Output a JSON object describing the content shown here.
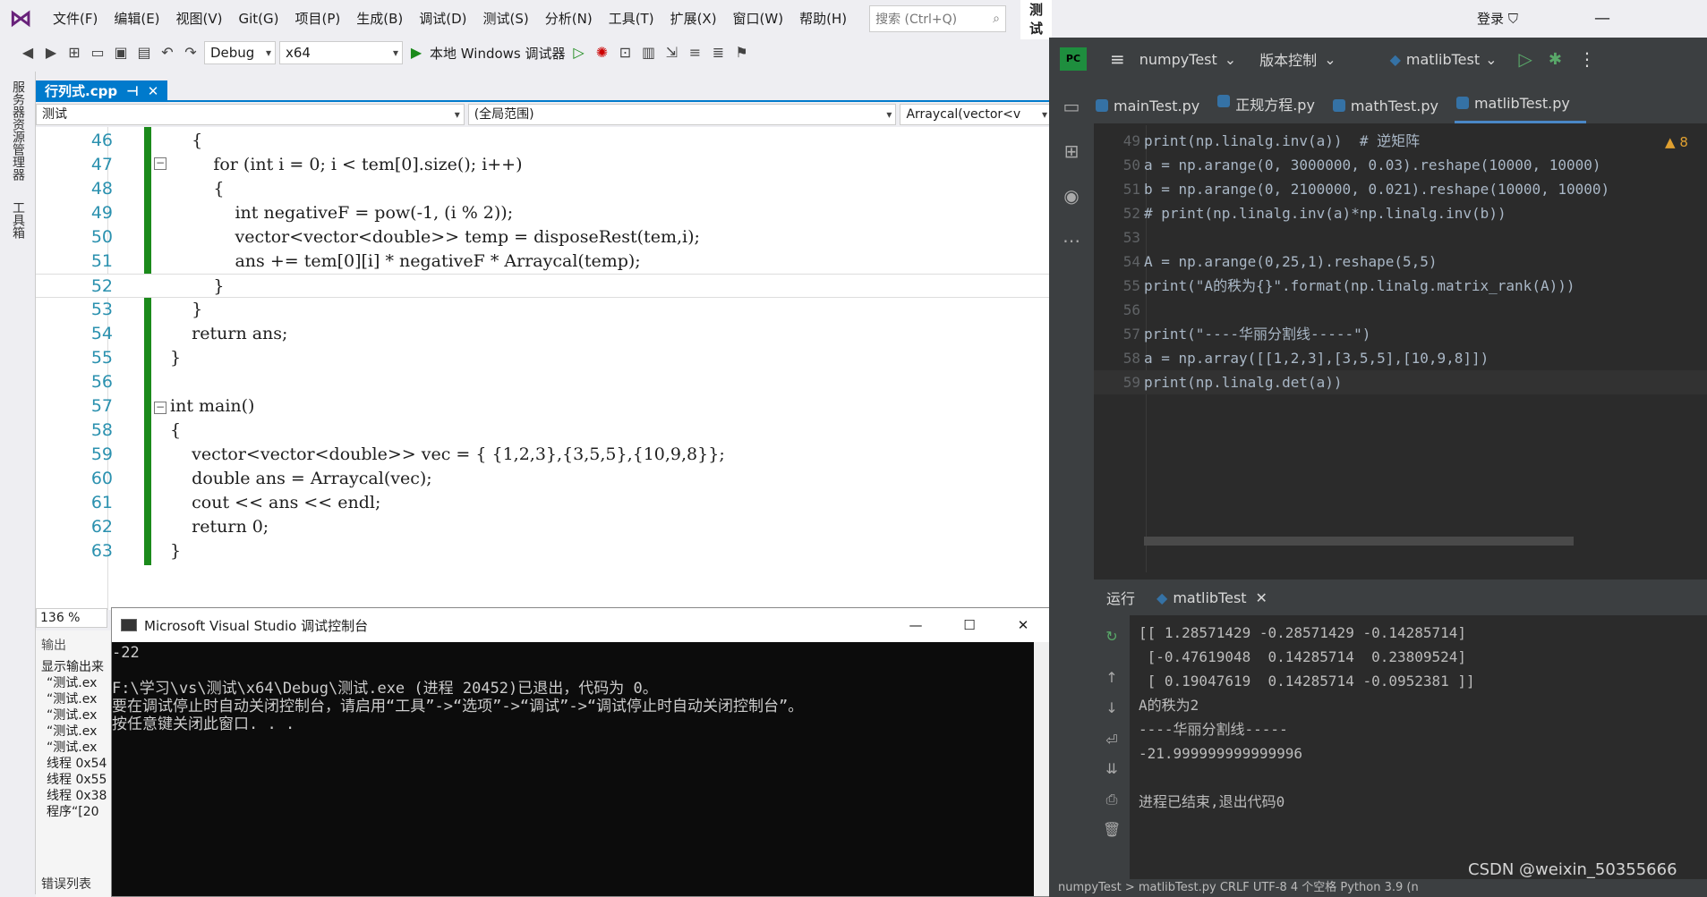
{
  "vs": {
    "menu": [
      "文件(F)",
      "编辑(E)",
      "视图(V)",
      "Git(G)",
      "项目(P)",
      "生成(B)",
      "调试(D)",
      "测试(S)",
      "分析(N)",
      "工具(T)",
      "扩展(X)",
      "窗口(W)",
      "帮助(H)"
    ],
    "search_placeholder": "搜索 (Ctrl+Q)",
    "solution_name": "测试",
    "login": "登录",
    "config": "Debug",
    "platform": "x64",
    "run_label": "本地 Windows 调试器",
    "file_tab": "行列式.cpp",
    "nav_project": "测试",
    "nav_scope": "(全局范围)",
    "nav_member": "Arraycal(vector<v",
    "zoom": "136 %",
    "side_labels": [
      "服务器资源管理器",
      "工具箱"
    ],
    "output_title": "输出",
    "output_source": "显示输出来",
    "output_lines": [
      "“测试.ex",
      "“测试.ex",
      "“测试.ex",
      "“测试.ex",
      "“测试.ex",
      "线程 0x54",
      "线程 0x55",
      "线程 0x38",
      "程序“[20"
    ],
    "error_list": "错误列表",
    "code": [
      {
        "ln": "46",
        "src": "    {"
      },
      {
        "ln": "47",
        "src": "        for (int i = 0; i < tem[0].size(); i++)"
      },
      {
        "ln": "48",
        "src": "        {"
      },
      {
        "ln": "49",
        "src": "            int negativeF = pow(-1, (i % 2));"
      },
      {
        "ln": "50",
        "src": "            vector<vector<double>> temp = disposeRest(tem,i);"
      },
      {
        "ln": "51",
        "src": "            ans += tem[0][i] * negativeF * Arraycal(temp);"
      },
      {
        "ln": "52",
        "src": "        }"
      },
      {
        "ln": "53",
        "src": "    }"
      },
      {
        "ln": "54",
        "src": "    return ans;"
      },
      {
        "ln": "55",
        "src": "}"
      },
      {
        "ln": "56",
        "src": ""
      },
      {
        "ln": "57",
        "src": "int main()"
      },
      {
        "ln": "58",
        "src": "{"
      },
      {
        "ln": "59",
        "src": "    vector<vector<double>> vec = { {1,2,3},{3,5,5},{10,9,8}};"
      },
      {
        "ln": "60",
        "src": "    double ans = Arraycal(vec);"
      },
      {
        "ln": "61",
        "src": "    cout << ans << endl;"
      },
      {
        "ln": "62",
        "src": "    return 0;"
      },
      {
        "ln": "63",
        "src": "}"
      }
    ]
  },
  "console": {
    "title": "Microsoft Visual Studio 调试控制台",
    "lines": [
      "-22",
      "",
      "F:\\学习\\vs\\测试\\x64\\Debug\\测试.exe (进程 20452)已退出，代码为 0。",
      "要在调试停止时自动关闭控制台，请启用“工具”->“选项”->“调试”->“调试停止时自动关闭控制台”。",
      "按任意键关闭此窗口. . ."
    ]
  },
  "pycharm": {
    "project": "numpyTest",
    "vcs": "版本控制",
    "run_config": "matlibTest",
    "tabs": [
      "mainTest.py",
      "正规方程.py",
      "mathTest.py",
      "matlibTest.py"
    ],
    "warnings": "8",
    "code": [
      {
        "ln": "49",
        "src": "print(np.linalg.inv(a))  # 逆矩阵"
      },
      {
        "ln": "50",
        "src": "a = np.arange(0, 3000000, 0.03).reshape(10000, 10000)"
      },
      {
        "ln": "51",
        "src": "b = np.arange(0, 2100000, 0.021).reshape(10000, 10000)"
      },
      {
        "ln": "52",
        "src": "# print(np.linalg.inv(a)*np.linalg.inv(b))"
      },
      {
        "ln": "53",
        "src": ""
      },
      {
        "ln": "54",
        "src": "A = np.arange(0,25,1).reshape(5,5)"
      },
      {
        "ln": "55",
        "src": "print(\"A的秩为{}\".format(np.linalg.matrix_rank(A)))"
      },
      {
        "ln": "56",
        "src": ""
      },
      {
        "ln": "57",
        "src": "print(\"----华丽分割线-----\")"
      },
      {
        "ln": "58",
        "src": "a = np.array([[1,2,3],[3,5,5],[10,9,8]])"
      },
      {
        "ln": "59",
        "src": "print(np.linalg.det(a))"
      }
    ],
    "run_label": "运行",
    "run_tab": "matlibTest",
    "output": [
      "[[ 1.28571429 -0.28571429 -0.14285714]",
      " [-0.47619048  0.14285714  0.23809524]",
      " [ 0.19047619  0.14285714 -0.0952381 ]]",
      "A的秩为2",
      "----华丽分割线-----",
      "-21.999999999999996",
      "",
      "进程已结束,退出代码0"
    ],
    "status": "numpyTest  >  matlibTest.py          CRLF    UTF-8    4 个空格    Python 3.9 (n",
    "watermark": "CSDN @weixin_50355666"
  }
}
